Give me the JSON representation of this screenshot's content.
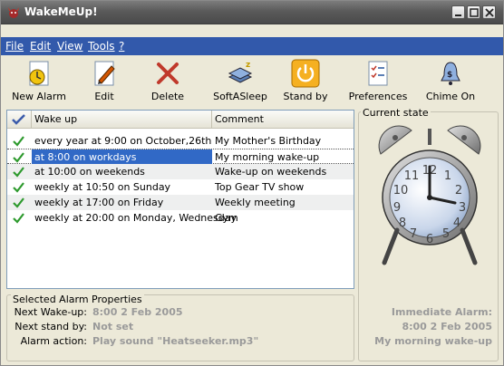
{
  "window": {
    "title": "WakeMeUp!"
  },
  "menu": {
    "file": "File",
    "edit": "Edit",
    "view": "View",
    "tools": "Tools",
    "help": "?"
  },
  "toolbar": {
    "new_alarm": "New Alarm",
    "edit": "Edit",
    "delete": "Delete",
    "softasleep": "SoftASleep",
    "standby": "Stand by",
    "preferences": "Preferences",
    "chime_on": "Chime On"
  },
  "alarm_list": {
    "columns": {
      "wake_up": "Wake up",
      "comment": "Comment"
    },
    "rows": [
      {
        "wake": "every year at 9:00 on October,26th",
        "comment": "My Mother's Birthday",
        "checked": true
      },
      {
        "wake": "at 8:00 on workdays",
        "comment": "My morning wake-up",
        "checked": true,
        "selected": true
      },
      {
        "wake": "at 10:00 on weekends",
        "comment": "Wake-up on weekends",
        "checked": true
      },
      {
        "wake": "weekly at 10:50 on Sunday",
        "comment": "Top Gear TV show",
        "checked": true
      },
      {
        "wake": "weekly at 17:00 on Friday",
        "comment": "Weekly meeting",
        "checked": true
      },
      {
        "wake": "weekly at 20:00 on Monday, Wednesday",
        "comment": "Gym",
        "checked": true
      }
    ]
  },
  "properties": {
    "title": "Selected Alarm Properties",
    "next_wakeup_label": "Next Wake-up:",
    "next_wakeup_value": "8:00 2 Feb 2005",
    "next_standby_label": "Next stand by:",
    "next_standby_value": "Not set",
    "action_label": "Alarm action:",
    "action_value": "Play sound \"Heatseeker.mp3\""
  },
  "state": {
    "title": "Current state",
    "immediate_label": "Immediate Alarm:",
    "immediate_time": "8:00 2 Feb 2005",
    "immediate_comment": "My morning wake-up"
  },
  "colors": {
    "menubar": "#3259ab",
    "selection": "#3169c6",
    "check": "#2e9a2e"
  }
}
